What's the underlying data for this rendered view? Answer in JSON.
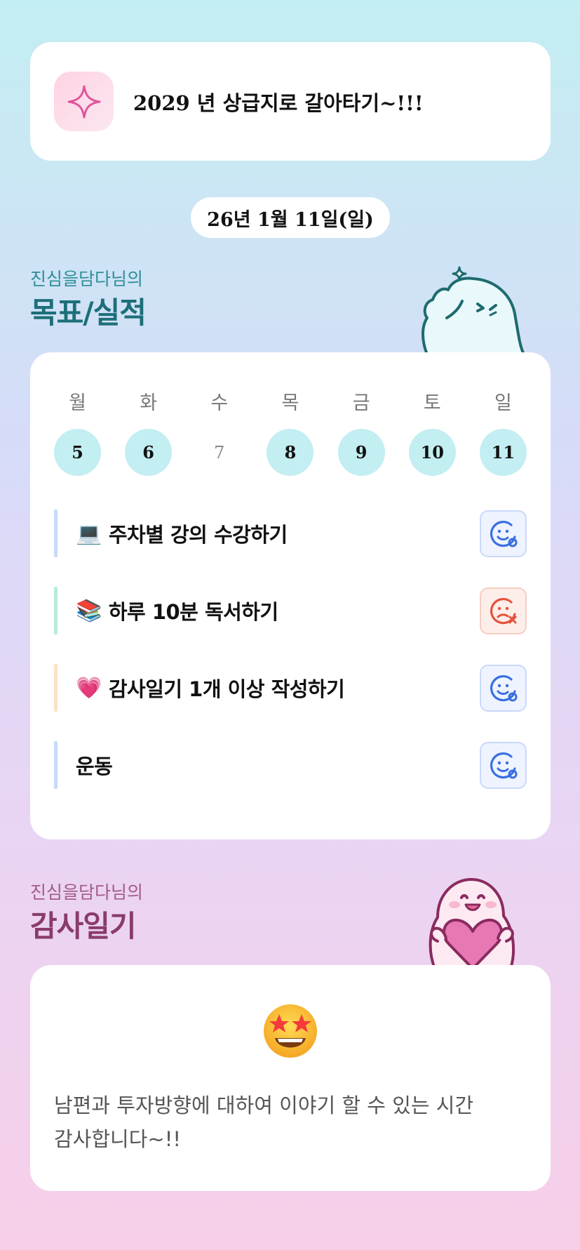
{
  "goal": {
    "text": "2029 년 상급지로 갈아타기~!!!",
    "icon": "sparkle-icon"
  },
  "date_label": "26년 1월 11일(일)",
  "tracker_section": {
    "owner": "진심을담다님의",
    "title": "목표/실적"
  },
  "week": {
    "weekdays": [
      "월",
      "화",
      "수",
      "목",
      "금",
      "토",
      "일"
    ],
    "days": [
      {
        "num": "5",
        "done": true
      },
      {
        "num": "6",
        "done": true
      },
      {
        "num": "7",
        "done": false
      },
      {
        "num": "8",
        "done": true
      },
      {
        "num": "9",
        "done": true
      },
      {
        "num": "10",
        "done": true
      },
      {
        "num": "11",
        "done": true
      }
    ]
  },
  "habits": [
    {
      "emoji": "💻",
      "label": "주차별 강의 수강하기",
      "status": "done",
      "bar_color": "#c9d8fb"
    },
    {
      "emoji": "📚",
      "label": "하루 10분 독서하기",
      "status": "missed",
      "bar_color": "#b6ecd6"
    },
    {
      "emoji": "💗",
      "label": "감사일기 1개 이상 작성하기",
      "status": "done",
      "bar_color": "#fbe2c2"
    },
    {
      "emoji": "",
      "label": "운동",
      "status": "done",
      "bar_color": "#c9d8fb"
    }
  ],
  "diary_section": {
    "owner": "진심을담다님의",
    "title": "감사일기"
  },
  "diary": {
    "emoji": "star-struck-emoji",
    "text_line1": "남편과 투자방향에 대하여 이야기 할 수 있는 시간",
    "text_line2": "감사합니다~!!"
  },
  "colors": {
    "teal_title": "#1c6f79",
    "pink_title": "#8a3b6a",
    "day_done": "#c3eef2",
    "status_ok": "#3a6fe0",
    "status_fail": "#e5533c"
  }
}
